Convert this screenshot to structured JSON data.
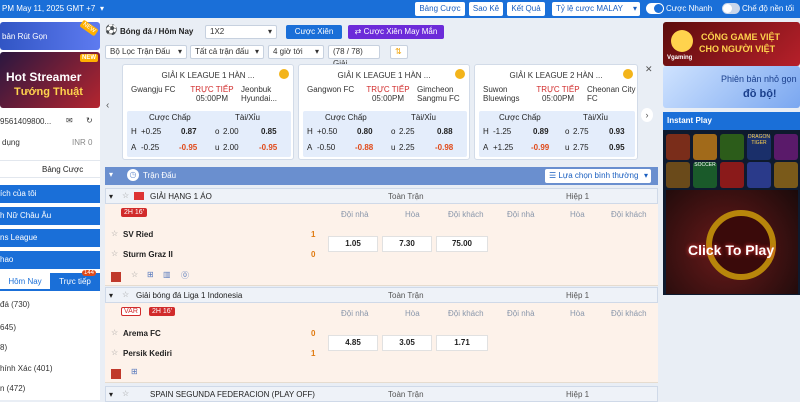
{
  "topbar": {
    "datetime": "PM May 11, 2025 GMT +7",
    "buttons": [
      "Bảng Cược",
      "Sao Kê",
      "Kết Quả"
    ],
    "odds_select": "Tỷ lệ cược MALAY",
    "quick_bet_label": "Cược Nhanh",
    "dark_mode_label": "Chế độ nền tối"
  },
  "sidebar": {
    "promo_text": "bản Rút Gọn",
    "new_badge": "NEW",
    "streamer_line1": "Hot Streamer",
    "streamer_line2": "Tướng Thuật",
    "account": "9561409800...",
    "balance_label": "dụng",
    "balance_value": "INR 0",
    "bet_slip_label": "Bảng Cược",
    "menu": [
      "ích của tôi",
      "h Nữ Châu Âu",
      "ns League",
      "hao"
    ],
    "tabs": [
      "Hôm Nay",
      "Trực tiếp"
    ],
    "live_count": "144",
    "sports": [
      "đá (730)",
      "645)",
      "8)",
      "hính Xác (401)",
      "n (472)"
    ]
  },
  "filter": {
    "sport_title": "Bóng đá / Hôm Nay",
    "market_select": "1X2",
    "btn_parlay": "Cược Xiên",
    "btn_lucky_parlay": "Cược Xiên May Mắn",
    "league_filter": "Bộ Lọc Trận Đấu",
    "all_matches": "Tất cả trận đấu",
    "time_filter": "4 giờ tới",
    "count": "(78 / 78) Giải"
  },
  "cards": [
    {
      "league": "GIẢI K LEAGUE 1 HÀN ...",
      "home": "Gwangju FC",
      "away": "Jeonbuk Hyundai...",
      "status": "TRỰC TIẾP",
      "time": "05:00PM",
      "hdr_handicap": "Cược Chấp",
      "hdr_ou": "Tài/Xỉu",
      "rows": [
        {
          "side": "H",
          "hcp": "+0.25",
          "hodd": "0.87",
          "ou": "o",
          "line": "2.00",
          "oodd": "0.85"
        },
        {
          "side": "A",
          "hcp": "-0.25",
          "hodd": "-0.95",
          "ou": "u",
          "line": "2.00",
          "oodd": "-0.95"
        }
      ]
    },
    {
      "league": "GIẢI K LEAGUE 1 HÀN ...",
      "home": "Gangwon FC",
      "away": "Gimcheon Sangmu FC",
      "status": "TRỰC TIẾP",
      "time": "05:00PM",
      "hdr_handicap": "Cược Chấp",
      "hdr_ou": "Tài/Xỉu",
      "rows": [
        {
          "side": "H",
          "hcp": "+0.50",
          "hodd": "0.80",
          "ou": "o",
          "line": "2.25",
          "oodd": "0.88"
        },
        {
          "side": "A",
          "hcp": "-0.50",
          "hodd": "-0.88",
          "ou": "u",
          "line": "2.25",
          "oodd": "-0.98"
        }
      ]
    },
    {
      "league": "GIẢI K LEAGUE 2 HÀN ...",
      "home": "Suwon Bluewings",
      "away": "Cheonan City FC",
      "status": "TRỰC TIẾP",
      "time": "05:00PM",
      "hdr_handicap": "Cược Chấp",
      "hdr_ou": "Tài/Xỉu",
      "rows": [
        {
          "side": "H",
          "hcp": "-1.25",
          "hodd": "0.89",
          "ou": "o",
          "line": "2.75",
          "oodd": "0.93"
        },
        {
          "side": "A",
          "hcp": "+1.25",
          "hodd": "-0.99",
          "ou": "u",
          "line": "2.75",
          "oodd": "0.95"
        }
      ]
    }
  ],
  "table": {
    "title": "Trận Đấu",
    "sort_select": "Lựa chọn bình thường",
    "full_time": "Toàn Trận",
    "half_time": "Hiệp 1",
    "col_home": "Đội nhà",
    "col_draw": "Hòa",
    "col_away": "Đội khách",
    "leagues": [
      {
        "name": "GIẢI HẠNG 1 ÁO",
        "status": "2H 16'",
        "home": "SV Ried",
        "away": "Sturm Graz II",
        "home_score": "1",
        "away_score": "0",
        "odds": [
          "1.05",
          "7.30",
          "75.00"
        ]
      },
      {
        "name": "Giải bóng đá Liga 1 Indonesia",
        "var": "VAR",
        "status": "2H 16'",
        "home": "Arema FC",
        "away": "Persik Kediri",
        "home_score": "0",
        "away_score": "1",
        "odds": [
          "4.85",
          "3.05",
          "1.71"
        ]
      }
    ],
    "next_league": "SPAIN SEGUNDA FEDERACION (PLAY OFF)"
  },
  "right": {
    "ad1_line1": "CỔNG GAME VIỆT",
    "ad1_line2": "CHO NGƯỜI VIỆT",
    "ad1_brand": "Vgaming",
    "ad2_line1": "Phiên bản nhỏ gọn",
    "ad2_line2": "đồ bộ!",
    "instant_title": "Instant Play",
    "game_labels": [
      "",
      "",
      "DRAGON TIGER",
      "",
      "SOCCER",
      "",
      "",
      ""
    ],
    "click_to_play": "Click To Play"
  },
  "colors": {
    "brand_blue": "#1a6fd8",
    "live_red": "#d12b2b",
    "negative_odd": "#e04a1a",
    "lucky_purple": "#6c2bd9"
  }
}
